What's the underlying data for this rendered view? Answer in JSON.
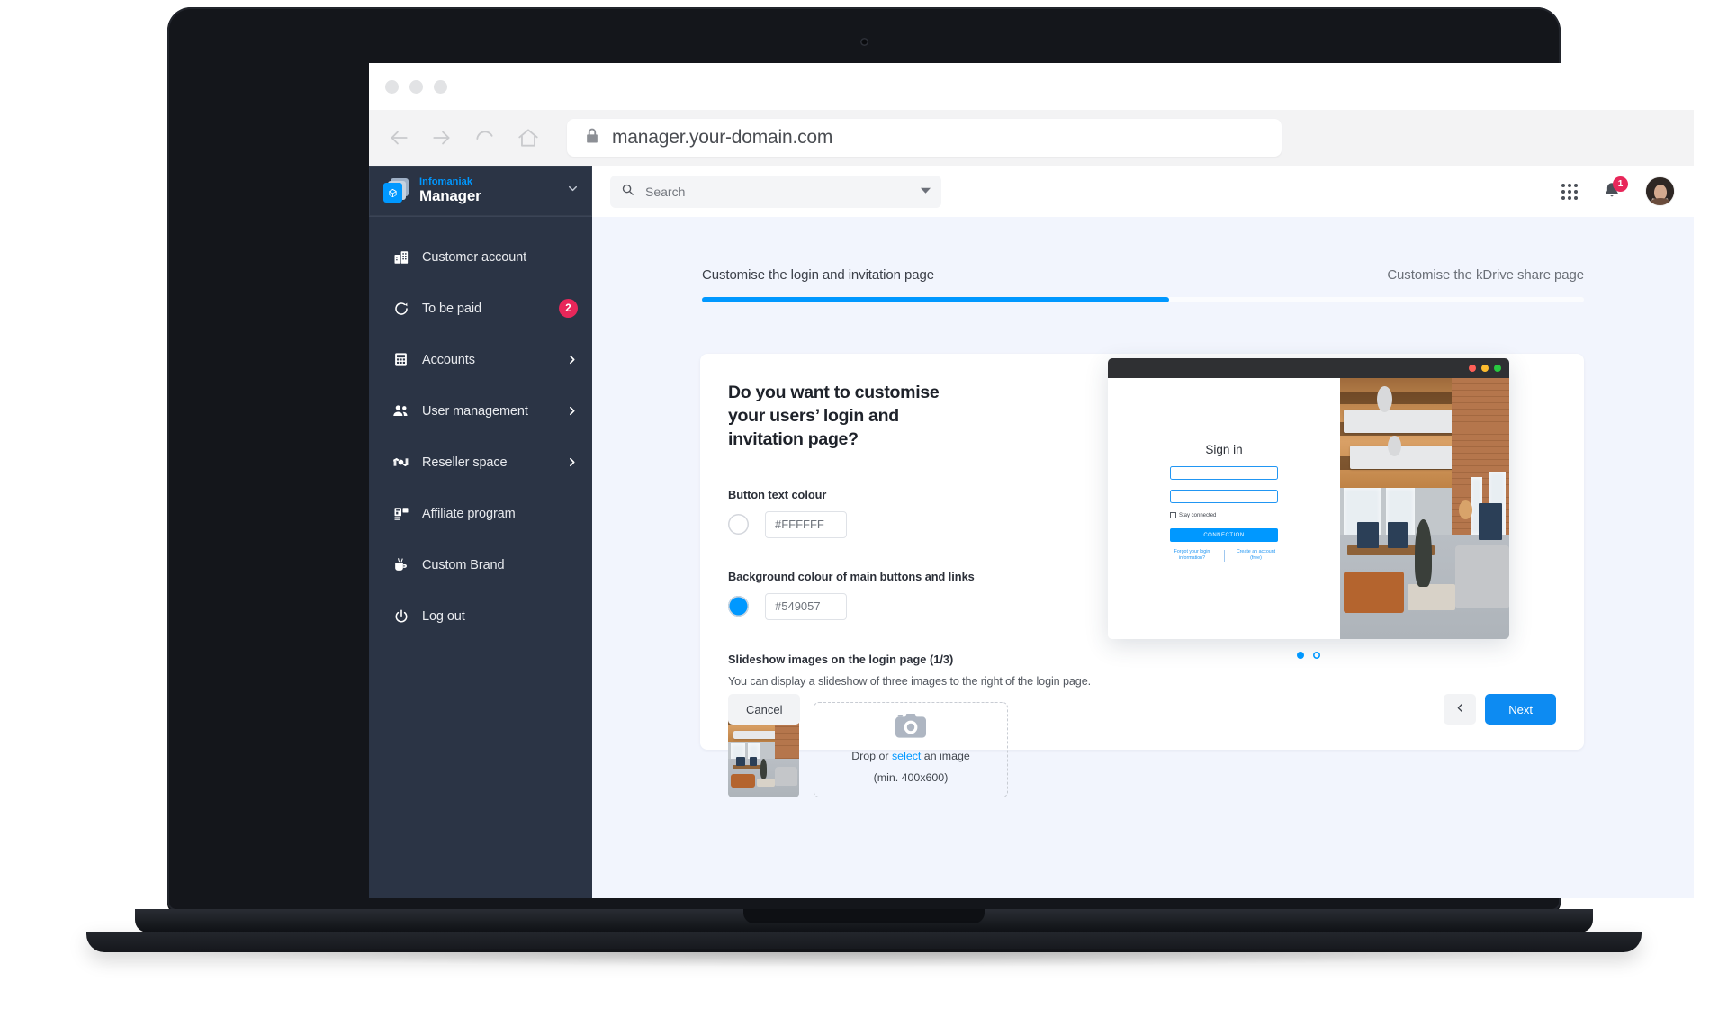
{
  "browser": {
    "url": "manager.your-domain.com",
    "lock_icon": "lock-icon",
    "back_icon": "back-arrow-icon",
    "forward_icon": "forward-arrow-icon",
    "reload_icon": "reload-icon",
    "home_icon": "home-icon"
  },
  "sidebar": {
    "brand": {
      "company": "Infomaniak",
      "product": "Manager",
      "logo_icon": "infomaniak-cube-logo",
      "caret_icon": "chevron-down-icon"
    },
    "items": [
      {
        "label": "Customer account",
        "icon": "building-icon",
        "badge": null,
        "chevron": false
      },
      {
        "label": "To be paid",
        "icon": "refresh-arrow-icon",
        "badge": "2",
        "chevron": false
      },
      {
        "label": "Accounts",
        "icon": "calculator-icon",
        "badge": null,
        "chevron": true
      },
      {
        "label": "User management",
        "icon": "users-icon",
        "badge": null,
        "chevron": true
      },
      {
        "label": "Reseller space",
        "icon": "handshake-money-icon",
        "badge": null,
        "chevron": true
      },
      {
        "label": "Affiliate program",
        "icon": "affiliate-chart-icon",
        "badge": null,
        "chevron": false
      },
      {
        "label": "Custom Brand",
        "icon": "paint-brush-cup-icon",
        "badge": null,
        "chevron": false
      },
      {
        "label": "Log out",
        "icon": "power-icon",
        "badge": null,
        "chevron": false
      }
    ]
  },
  "topbar": {
    "search": {
      "placeholder": "Search",
      "icon": "search-icon",
      "caret_icon": "chevron-down-icon"
    },
    "apps_icon": "apps-grid-icon",
    "notifications": {
      "icon": "bell-icon",
      "count": "1"
    },
    "avatar": "user-avatar"
  },
  "stepper": {
    "steps": [
      {
        "label": "Customise the login and invitation page",
        "active": true
      },
      {
        "label": "Customise the kDrive share page",
        "active": false
      }
    ],
    "progress_percent": 53
  },
  "form": {
    "title": "Do you want to customise your users’ login and invitation page?",
    "fields": [
      {
        "label": "Button text colour",
        "value": "#FFFFFF",
        "swatch_color": "#FFFFFF",
        "swatch_filled": false
      },
      {
        "label": "Background colour of main buttons and links",
        "value": "#549057",
        "swatch_color": "#0098FF",
        "swatch_filled": true
      }
    ],
    "slideshow": {
      "heading": "Slideshow images on the login page (1/3)",
      "description": "You can display a slideshow of three images to the right of the login page.",
      "thumbnail_alt": "office-interior-thumbnail",
      "dropzone": {
        "icon": "camera-icon",
        "line1_prefix": "Drop or ",
        "line1_link": "select",
        "line1_suffix": " an image",
        "line2": "(min. 400x600)"
      }
    }
  },
  "preview": {
    "window_dots": [
      "#ff5f57",
      "#febc2e",
      "#28c840"
    ],
    "signin_title": "Sign in",
    "stay_connected_label": "Stay connected",
    "connect_button": "CONNECTION",
    "forgot_link": "Forgot your login information?",
    "create_link": "Create an account (free)",
    "carousel": [
      {
        "state": "active"
      },
      {
        "state": "inactive"
      }
    ]
  },
  "footer": {
    "cancel_label": "Cancel",
    "prev_icon": "chevron-left-icon",
    "next_label": "Next"
  },
  "colors": {
    "accent": "#0098FF",
    "sidebar_bg": "#2B3445",
    "badge": "#E8275A",
    "page_bg": "#F2F5FD",
    "next_button": "#0D8BF2"
  }
}
